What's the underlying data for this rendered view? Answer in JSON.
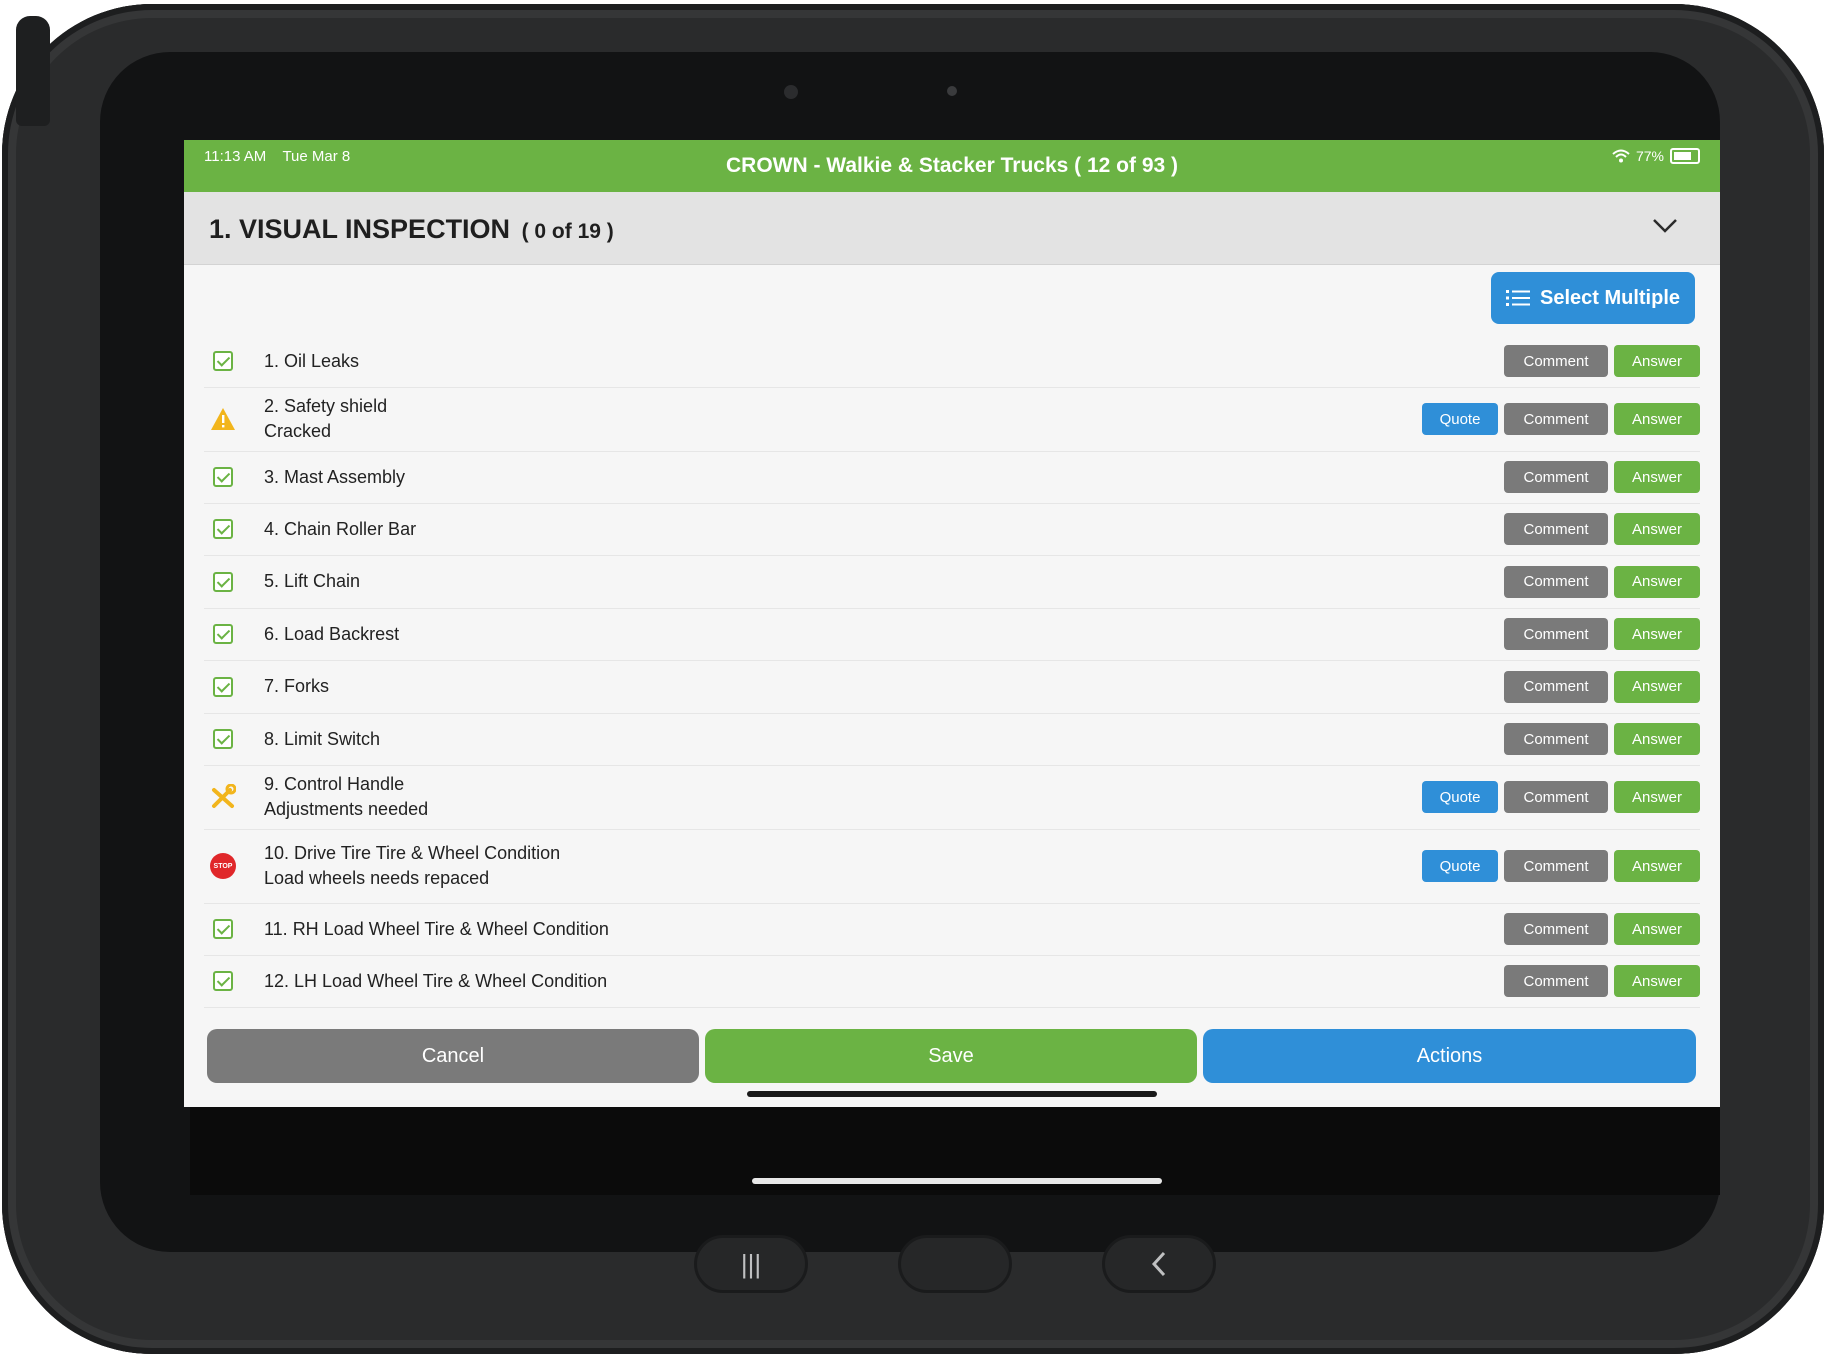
{
  "status_bar": {
    "time": "11:13 AM",
    "date": "Tue Mar 8",
    "title": "CROWN - Walkie & Stacker Trucks ( 12 of 93 )",
    "battery": "77%"
  },
  "section": {
    "title": "1. VISUAL INSPECTION",
    "count": "( 0 of 19 )"
  },
  "select_multiple_label": "Select Multiple",
  "buttons": {
    "quote": "Quote",
    "comment": "Comment",
    "answer": "Answer"
  },
  "items": [
    {
      "label": "1. Oil Leaks",
      "note": "",
      "status": "ok",
      "icon": "checkbox-checked-icon",
      "quote": false
    },
    {
      "label": "2. Safety shield",
      "note": "Cracked",
      "status": "warning",
      "icon": "warning-icon",
      "quote": true
    },
    {
      "label": "3. Mast Assembly",
      "note": "",
      "status": "ok",
      "icon": "checkbox-checked-icon",
      "quote": false
    },
    {
      "label": "4. Chain Roller Bar",
      "note": "",
      "status": "ok",
      "icon": "checkbox-checked-icon",
      "quote": false
    },
    {
      "label": "5. Lift Chain",
      "note": "",
      "status": "ok",
      "icon": "checkbox-checked-icon",
      "quote": false
    },
    {
      "label": "6. Load Backrest",
      "note": "",
      "status": "ok",
      "icon": "checkbox-checked-icon",
      "quote": false
    },
    {
      "label": "7. Forks",
      "note": "",
      "status": "ok",
      "icon": "checkbox-checked-icon",
      "quote": false
    },
    {
      "label": "8. Limit Switch",
      "note": "",
      "status": "ok",
      "icon": "checkbox-checked-icon",
      "quote": false
    },
    {
      "label": "9. Control Handle",
      "note": "Adjustments needed",
      "status": "adjust",
      "icon": "wrench-icon",
      "quote": true
    },
    {
      "label": "10. Drive Tire Tire & Wheel Condition",
      "note": "Load wheels needs repaced",
      "status": "stop",
      "icon": "stop-icon",
      "quote": true
    },
    {
      "label": "11. RH Load Wheel Tire & Wheel Condition",
      "note": "",
      "status": "ok",
      "icon": "checkbox-checked-icon",
      "quote": false
    },
    {
      "label": "12. LH Load Wheel Tire & Wheel Condition",
      "note": "",
      "status": "ok",
      "icon": "checkbox-checked-icon",
      "quote": false
    }
  ],
  "stop_icon_text": "STOP",
  "footer": {
    "cancel": "Cancel",
    "save": "Save",
    "actions": "Actions"
  },
  "colors": {
    "green": "#6bb344",
    "blue": "#2f8fd8",
    "gray": "#7a7a7a",
    "warning": "#f2b51c",
    "stop": "#e0272a"
  }
}
